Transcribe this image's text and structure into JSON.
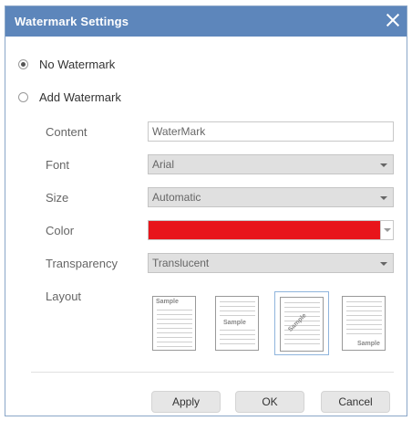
{
  "dialog": {
    "title": "Watermark Settings",
    "title_bar_color": "#5d86bb",
    "close_icon": "close-icon"
  },
  "options": {
    "no_watermark_label": "No Watermark",
    "add_watermark_label": "Add Watermark",
    "selected": "no_watermark"
  },
  "form": {
    "content_label": "Content",
    "content_value": "WaterMark",
    "font_label": "Font",
    "font_value": "Arial",
    "size_label": "Size",
    "size_value": "Automatic",
    "color_label": "Color",
    "color_value": "#e8151b",
    "transparency_label": "Transparency",
    "transparency_value": "Translucent",
    "layout_label": "Layout"
  },
  "layouts": {
    "sample_text": "Sample",
    "selected_index": 2
  },
  "buttons": {
    "apply": "Apply",
    "ok": "OK",
    "cancel": "Cancel"
  }
}
